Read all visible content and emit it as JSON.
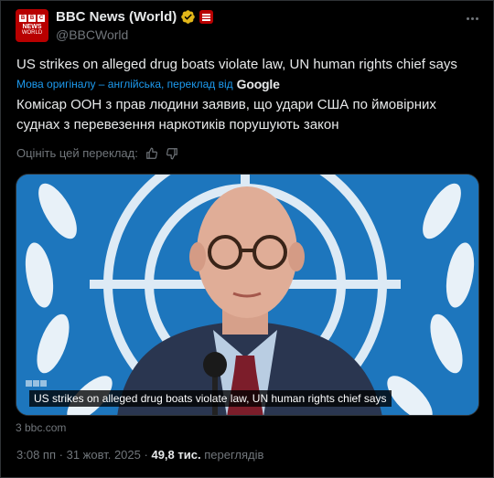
{
  "author": {
    "display_name": "BBC News (World)",
    "handle": "@BBCWorld",
    "avatar_text": "BBC",
    "avatar_news": "NEWS",
    "avatar_world": "WORLD",
    "verified_icon": "gold-check-icon",
    "affiliation_icon": "bbc-affiliate-icon"
  },
  "post": {
    "original_text": "US strikes on alleged drug boats violate law, UN human rights chief says",
    "translation_note": "Мова оригіналу – англійська, переклад від",
    "translator": "Google",
    "translated_text": "Комісар ООН з прав людини заявив, що удари США по ймовірних суднах з перевезення наркотиків порушують закон",
    "rate_label": "Оцініть цей переклад:",
    "media_caption": "US strikes on alleged drug boats violate law, UN human rights chief says",
    "link_source": "3 bbc.com"
  },
  "meta": {
    "time": "3:08 пп",
    "separator": "·",
    "date": "31 жовт. 2025",
    "views_count": "49,8 тис.",
    "views_label": "переглядів"
  },
  "colors": {
    "background": "#000000",
    "text": "#e7e9ea",
    "muted": "#71767b",
    "link": "#1d9bf0",
    "bbc_red": "#b80000",
    "verified_gold": "#e2b719"
  }
}
